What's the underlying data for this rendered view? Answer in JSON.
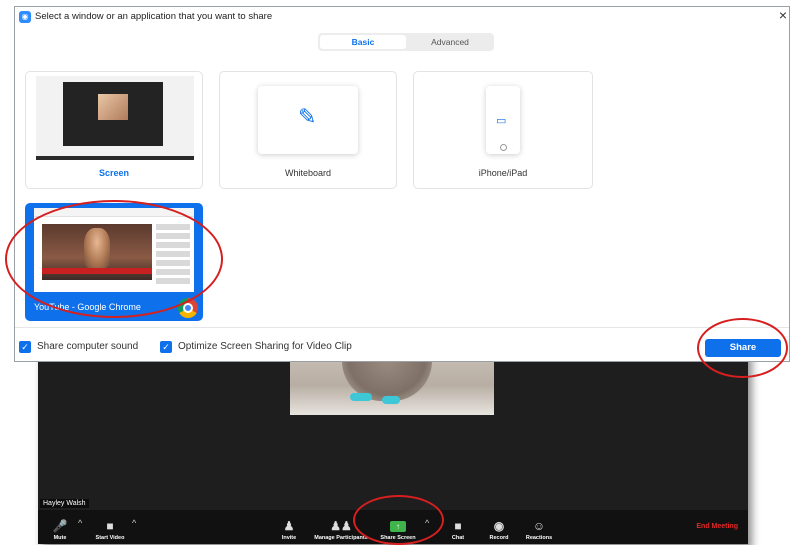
{
  "dialog": {
    "title": "Select a window or an application that you want to share",
    "close_glyph": "×",
    "tabs": [
      {
        "label": "Basic",
        "selected": true
      },
      {
        "label": "Advanced",
        "selected": false
      }
    ],
    "tiles": {
      "screen": "Screen",
      "whiteboard": "Whiteboard",
      "iphone": "iPhone/iPad",
      "youtube": "YouTube - Google Chrome"
    },
    "share_sound_label": "Share computer sound",
    "optimize_label": "Optimize Screen Sharing for Video Clip",
    "share_button": "Share",
    "accent": "#0e71eb"
  },
  "meeting": {
    "participant_name": "Hayley Walsh",
    "toolbar": {
      "mute": "Mute",
      "start_video": "Start Video",
      "invite": "Invite",
      "manage_participants": "Manage Participants",
      "share_screen": "Share Screen",
      "chat": "Chat",
      "record": "Record",
      "reactions": "Reactions",
      "end_meeting": "End Meeting"
    },
    "end_color": "#e02828"
  }
}
